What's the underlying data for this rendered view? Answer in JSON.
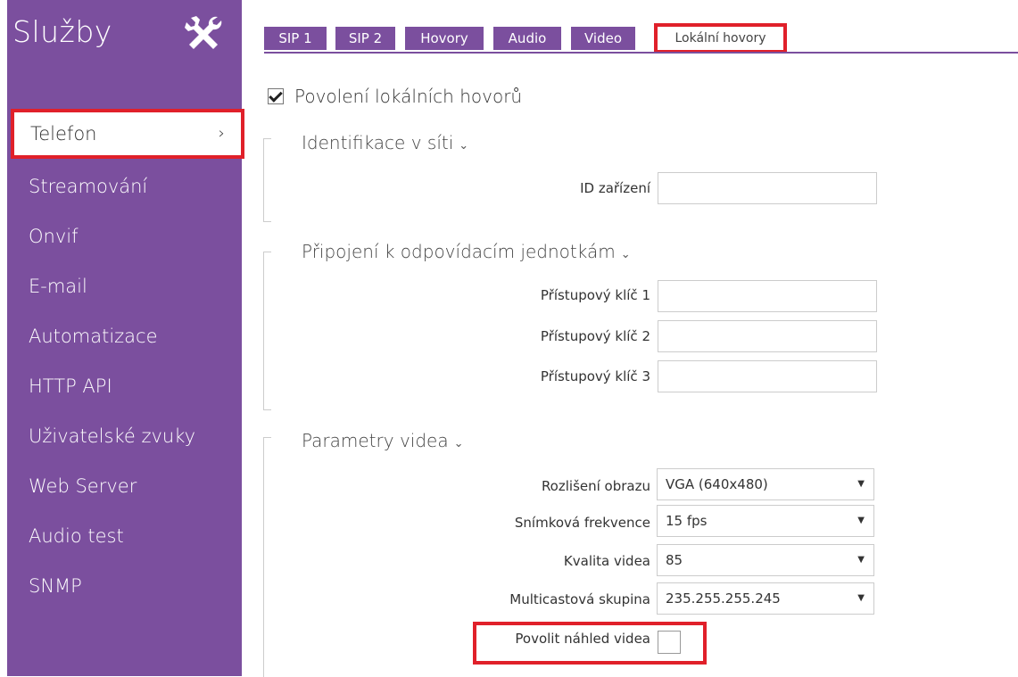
{
  "sidebar": {
    "title": "Služby",
    "tools_icon": "tools-icon",
    "items": [
      {
        "label": "Telefon",
        "active": true
      },
      {
        "label": "Streamování"
      },
      {
        "label": "Onvif"
      },
      {
        "label": "E-mail"
      },
      {
        "label": "Automatizace"
      },
      {
        "label": "HTTP API"
      },
      {
        "label": "Uživatelské zvuky"
      },
      {
        "label": "Web Server"
      },
      {
        "label": "Audio test"
      },
      {
        "label": "SNMP"
      }
    ],
    "active_chevron": "›"
  },
  "tabs": [
    {
      "label": "SIP 1"
    },
    {
      "label": "SIP 2"
    },
    {
      "label": "Hovory"
    },
    {
      "label": "Audio"
    },
    {
      "label": "Video"
    },
    {
      "label": "Lokální hovory",
      "active": true
    }
  ],
  "enable_local_calls": {
    "label": "Povolení lokálních hovorů",
    "checked": true
  },
  "sections": {
    "network": {
      "title": "Identifikace v síti",
      "device_id_label": "ID zařízení",
      "device_id_value": ""
    },
    "responders": {
      "title": "Připojení k odpovídacím jednotkám",
      "key1_label": "Přístupový klíč 1",
      "key2_label": "Přístupový klíč 2",
      "key3_label": "Přístupový klíč 3"
    },
    "video": {
      "title": "Parametry videa",
      "resolution_label": "Rozlišení obrazu",
      "resolution_value": "VGA (640x480)",
      "framerate_label": "Snímková frekvence",
      "framerate_value": "15 fps",
      "quality_label": "Kvalita videa",
      "quality_value": "85",
      "multicast_label": "Multicastová skupina",
      "multicast_value": "235.255.255.245",
      "preview_label": "Povolit náhled videa",
      "preview_checked": false
    }
  },
  "caret": "⌄",
  "select_arrow": "▼",
  "colors": {
    "accent": "#7b4f9e",
    "highlight": "#e0202a"
  }
}
